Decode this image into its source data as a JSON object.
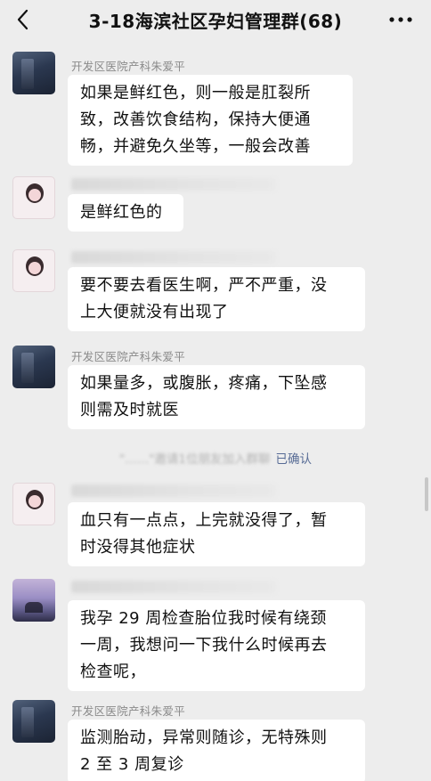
{
  "header": {
    "title": "3-18海滨社区孕妇管理群(68)",
    "back_icon": "chevron-left-icon",
    "more_icon": "ellipsis-icon"
  },
  "messages": [
    {
      "sender": "开发区医院产科朱爱平",
      "avatar": "doctor",
      "lines": [
        "如果是鲜红色，则一般是肛裂所",
        "致，改善饮食结构，保持大便通",
        "畅，并避免久坐等，一般会改善"
      ]
    },
    {
      "sender": "",
      "avatar": "girl",
      "lines": [
        "是鲜红色的"
      ]
    },
    {
      "sender": "",
      "avatar": "girl",
      "lines": [
        "要不要去看医生啊，严不严重，没",
        "上大便就没有出现了"
      ]
    },
    {
      "sender": "开发区医院产科朱爱平",
      "avatar": "doctor",
      "lines": [
        "如果量多，或腹胀，疼痛，下坠感",
        "则需及时就医"
      ]
    },
    {
      "sender": "",
      "avatar": "girl",
      "lines": [
        "血只有一点点，上完就没得了，暂",
        "时没得其他症状"
      ]
    },
    {
      "sender": "",
      "avatar": "sunset",
      "lines": [
        "我孕 29 周检查胎位我时候有绕颈",
        "一周，我想问一下我什么时候再去",
        "检查呢，"
      ]
    },
    {
      "sender": "开发区医院产科朱爱平",
      "avatar": "doctor",
      "lines": [
        "监测胎动，异常则随诊，无特殊则",
        "2 至 3 周复诊"
      ]
    }
  ],
  "system_notice": {
    "text": "\"……\"邀请1位朋友加入群聊",
    "link": "已确认"
  }
}
